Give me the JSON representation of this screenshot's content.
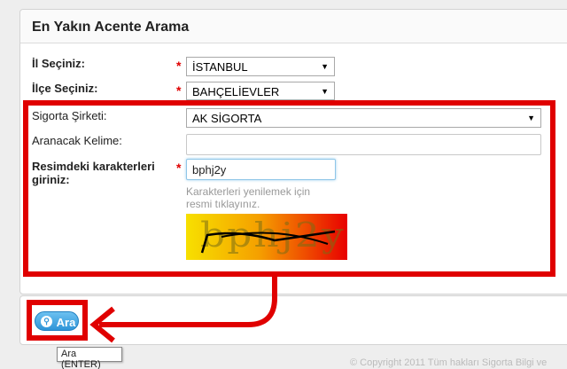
{
  "panel": {
    "title": "En Yakın Acente Arama"
  },
  "form": {
    "il_label": "İl Seçiniz:",
    "il_value": "İSTANBUL",
    "ilce_label": "İlçe Seçiniz:",
    "ilce_value": "BAHÇELİEVLER",
    "sirket_label": "Sigorta Şirketi:",
    "sirket_value": "AK SİGORTA",
    "kelime_label": "Aranacak Kelime:",
    "kelime_value": "",
    "captcha_label_1": "Resimdeki karakterleri",
    "captcha_label_2": "giriniz:",
    "captcha_value": "bphj2y",
    "captcha_hint_1": "Karakterleri yenilemek için",
    "captcha_hint_2": "resmi tıklayınız.",
    "captcha_image_text": "bphj2y",
    "required_mark": "*",
    "dropdown_arrow": "▼"
  },
  "actions": {
    "search_label": "Ara",
    "search_tooltip": "Ara (ENTER)"
  },
  "footer": {
    "copyright": "© Copyright 2011 Tüm hakları Sigorta Bilgi ve"
  },
  "colors": {
    "annotation": "#e00000",
    "button": "#2f95d8"
  }
}
